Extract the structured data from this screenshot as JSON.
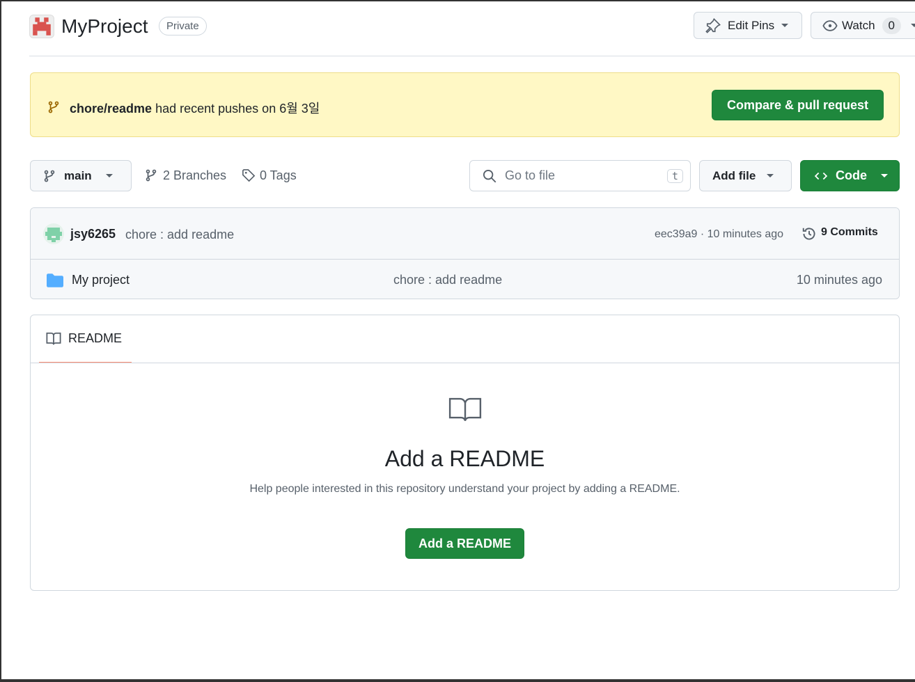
{
  "header": {
    "repo_name": "MyProject",
    "visibility": "Private",
    "edit_pins": "Edit Pins",
    "watch": "Watch",
    "watch_count": "0"
  },
  "banner": {
    "branch": "chore/readme",
    "text": "had recent pushes on 6월 3일",
    "button": "Compare & pull request"
  },
  "toolbar": {
    "branch": "main",
    "branches": "2 Branches",
    "tags": "0 Tags",
    "search_placeholder": "Go to file",
    "search_shortcut": "t",
    "add_file": "Add file",
    "code": "Code"
  },
  "commit": {
    "author": "jsy6265",
    "message": "chore : add readme",
    "hash_time": "eec39a9 · 10 minutes ago",
    "commits": "9 Commits"
  },
  "files": [
    {
      "name": "My project",
      "message": "chore : add readme",
      "time": "10 minutes ago"
    }
  ],
  "readme": {
    "tab": "README",
    "title": "Add a README",
    "description": "Help people interested in this repository understand your project by adding a README.",
    "button": "Add a README"
  },
  "colors": {
    "accent_green": "#1f883d",
    "banner_bg": "#fff8c5",
    "tab_underline": "#fd8c73",
    "folder": "#54aeff"
  }
}
